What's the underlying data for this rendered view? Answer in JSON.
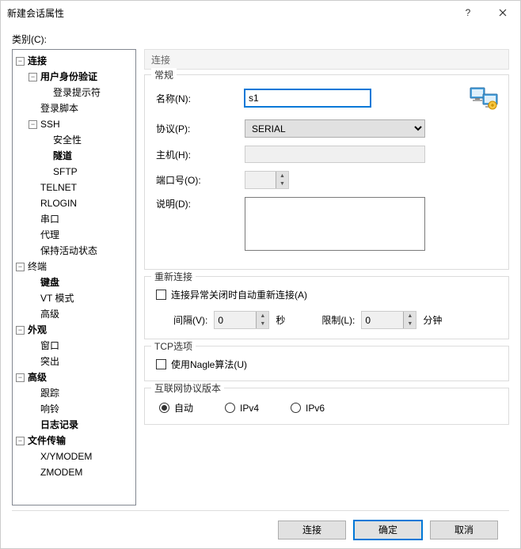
{
  "title": "新建会话属性",
  "category_label": "类别(C):",
  "tree": {
    "connection": "连接",
    "auth": "用户身份验证",
    "login_prompt": "登录提示符",
    "login_script": "登录脚本",
    "ssh": "SSH",
    "security": "安全性",
    "tunnel": "隧道",
    "sftp": "SFTP",
    "telnet": "TELNET",
    "rlogin": "RLOGIN",
    "serial": "串口",
    "proxy": "代理",
    "keepalive": "保持活动状态",
    "terminal": "终端",
    "keyboard": "键盘",
    "vt": "VT 模式",
    "advanced1": "高级",
    "appearance": "外观",
    "window": "窗口",
    "highlight": "突出",
    "advanced": "高级",
    "trace": "跟踪",
    "bell": "响铃",
    "logging": "日志记录",
    "filetransfer": "文件传输",
    "xymodem": "X/YMODEM",
    "zmodem": "ZMODEM"
  },
  "header": "连接",
  "general": {
    "legend": "常规",
    "name_label": "名称(N):",
    "name_value": "s1",
    "protocol_label": "协议(P):",
    "protocol_value": "SERIAL",
    "host_label": "主机(H):",
    "host_value": "",
    "port_label": "端口号(O):",
    "port_value": "",
    "desc_label": "说明(D):",
    "desc_value": ""
  },
  "reconnect": {
    "legend": "重新连接",
    "chk_label": "连接异常关闭时自动重新连接(A)",
    "interval_label": "间隔(V):",
    "interval_value": "0",
    "interval_unit": "秒",
    "limit_label": "限制(L):",
    "limit_value": "0",
    "limit_unit": "分钟"
  },
  "tcp": {
    "legend": "TCP选项",
    "nagle_label": "使用Nagle算法(U)"
  },
  "ipver": {
    "legend": "互联网协议版本",
    "auto": "自动",
    "ipv4": "IPv4",
    "ipv6": "IPv6"
  },
  "footer": {
    "connect": "连接",
    "ok": "确定",
    "cancel": "取消"
  }
}
